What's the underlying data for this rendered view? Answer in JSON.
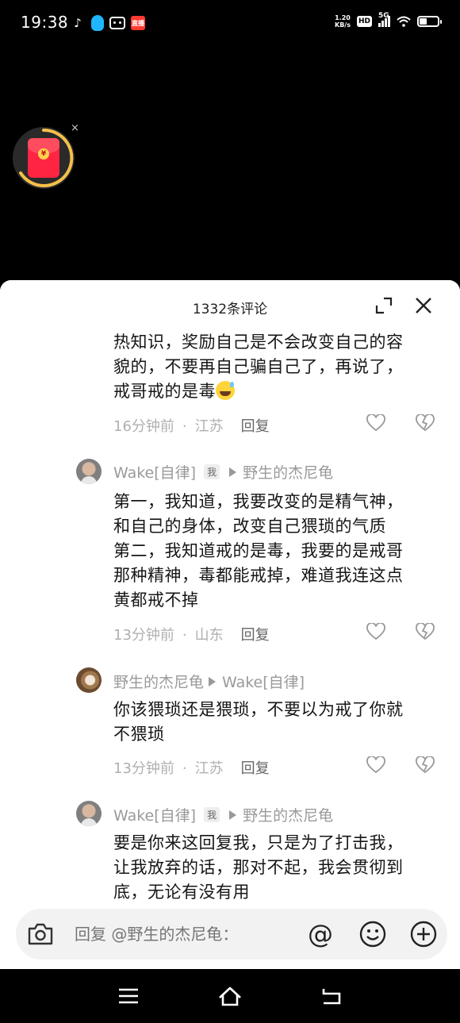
{
  "status_bar": {
    "time": "19:38",
    "app_red_icon": "直播",
    "net_speed_value": "1.20",
    "net_speed_unit": "KB/s",
    "hd": "HD",
    "network": "5G"
  },
  "red_packet": {
    "close": "×",
    "coin": "¥"
  },
  "sheet": {
    "title": "1332条评论"
  },
  "comments": [
    {
      "text_lines": [
        "热知识，奖励自己是不会改变自己的容",
        "貌的，不要再自己骗自己了，再说了，",
        "戒哥戒的是毒"
      ],
      "time": "16分钟前",
      "separator": "·",
      "location": "江苏",
      "reply_label": "回复"
    },
    {
      "author": "Wake[自律]",
      "badge": "我",
      "reply_to": "野生的杰尼龟",
      "text_lines": [
        "第一，我知道，我要改变的是精气神，",
        "和自己的身体，改变自己猥琐的气质",
        "第二，我知道戒的是毒，我要的是戒哥",
        "那种精神，毒都能戒掉，难道我连这点",
        "黄都戒不掉"
      ],
      "time": "13分钟前",
      "separator": "·",
      "location": "山东",
      "reply_label": "回复"
    },
    {
      "author": "野生的杰尼龟",
      "reply_to": "Wake[自律]",
      "text_lines": [
        "你该猥琐还是猥琐，不要以为戒了你就",
        "不猥琐"
      ],
      "time": "13分钟前",
      "separator": "·",
      "location": "江苏",
      "reply_label": "回复"
    },
    {
      "author": "Wake[自律]",
      "badge": "我",
      "reply_to": "野生的杰尼龟",
      "text_lines": [
        "要是你来这回复我，只是为了打击我，",
        "让我放弃的话，那对不起，我会贯彻到",
        "底，无论有没有用"
      ]
    }
  ],
  "input_bar": {
    "placeholder": "回复 @野生的杰尼龟："
  },
  "icons": [
    "tiktok-icon",
    "qq-icon",
    "bilibili-icon",
    "expand-icon",
    "close-icon",
    "like-icon",
    "dislike-icon",
    "camera-icon",
    "at-icon",
    "emoji-icon",
    "plus-icon",
    "nav-menu-icon",
    "nav-home-icon",
    "nav-back-icon"
  ]
}
